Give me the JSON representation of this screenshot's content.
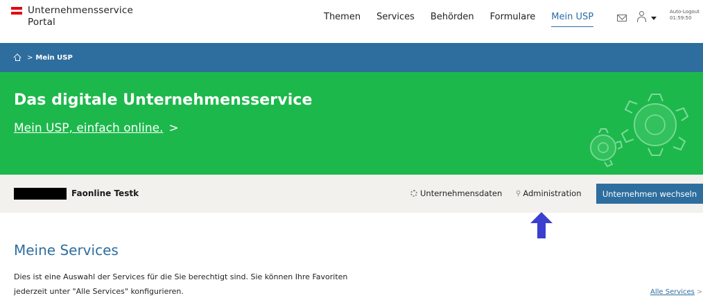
{
  "header": {
    "logo_line1": "Unternehmensservice",
    "logo_line2": "Portal",
    "nav": [
      {
        "label": "Themen"
      },
      {
        "label": "Services"
      },
      {
        "label": "Behörden"
      },
      {
        "label": "Formulare"
      },
      {
        "label": "Mein USP",
        "active": true
      }
    ],
    "icons": [
      "mail-icon",
      "user-icon",
      "caret-down-icon"
    ],
    "autologout_label": "Auto-Logout",
    "autologout_time": "01:59:50"
  },
  "breadcrumb": {
    "home_icon": "home-icon",
    "separator": ">",
    "current": "Mein USP"
  },
  "hero": {
    "title": "Das digitale Unternehmensservice",
    "link": "Mein USP, einfach online.",
    "arrow": ">"
  },
  "company_bar": {
    "company_name": "Faonline Testk",
    "company_data_label": "Unternehmensdaten",
    "administration_label": "Administration",
    "switch_button": "Unternehmen wechseln"
  },
  "services": {
    "title": "Meine Services",
    "desc_line1": "Dies ist eine Auswahl der Services für die Sie berechtigt sind. Sie können Ihre Favoriten",
    "desc_line2": "jederzeit unter \"Alle Services\" konfigurieren.",
    "all_services_link": "Alle Services",
    "chevron": ">"
  },
  "colors": {
    "primary_blue": "#2e6e9e",
    "hero_green": "#1db84b",
    "company_bar_bg": "#f3f1ee",
    "arrow_annotation": "#3a3fcf"
  }
}
